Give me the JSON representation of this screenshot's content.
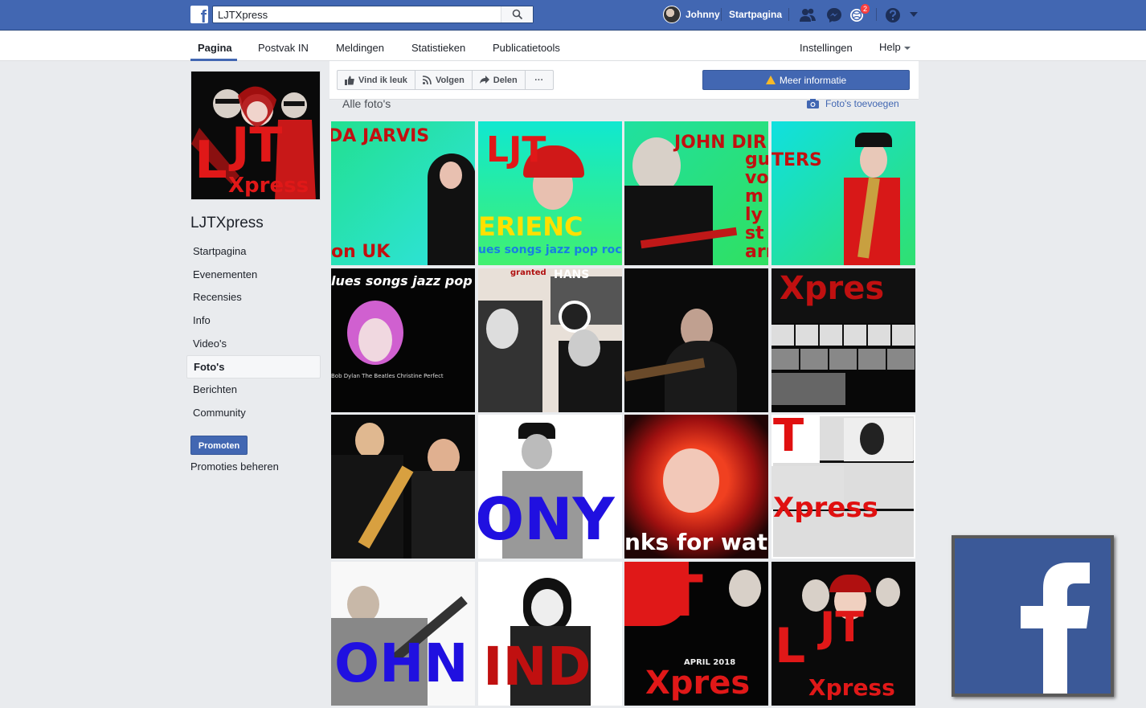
{
  "topbar": {
    "search_value": "LJTXpress",
    "user_name": "Johnny",
    "home_label": "Startpagina",
    "notification_count": "2"
  },
  "pagenav": {
    "tabs": [
      "Pagina",
      "Postvak IN",
      "Meldingen",
      "Statistieken",
      "Publicatietools"
    ],
    "settings": "Instellingen",
    "help": "Help"
  },
  "page": {
    "name": "LJTXpress",
    "profile_text": "LJTXpress"
  },
  "sidebar": {
    "items": [
      "Startpagina",
      "Evenementen",
      "Recensies",
      "Info",
      "Video's",
      "Foto's",
      "Berichten",
      "Community"
    ],
    "promote_label": "Promoten",
    "manage_promotions": "Promoties beheren"
  },
  "actions": {
    "like": "Vind ik leuk",
    "follow": "Volgen",
    "share": "Delen",
    "more": "···",
    "more_info": "Meer informatie"
  },
  "photos": {
    "heading": "Alle foto's",
    "add_label": "Foto's toevoegen",
    "tiles": [
      {
        "text": "DA JARVIS",
        "sub": "ls s nm s on UK"
      },
      {
        "text": "LJT",
        "sub": "ERIENC",
        "caption": "ues songs jazz pop rock"
      },
      {
        "text": "JOHN DIR",
        "sub": "gu vo m ly st arn"
      },
      {
        "text": "TERS",
        "sub": "n"
      },
      {
        "text": "lues songs jazz pop ro",
        "sub": "Bob Dylan The Beatles Christine Perfect"
      },
      {
        "text": "HANS",
        "sub": "granted"
      },
      {
        "text": ""
      },
      {
        "text": "Xpres"
      },
      {
        "text": ""
      },
      {
        "text": "ONY"
      },
      {
        "text": "nks for watc"
      },
      {
        "text": "Xpress"
      },
      {
        "text": "OHN"
      },
      {
        "text": "IND"
      },
      {
        "text": "Xpres",
        "sub": "APRIL 2018"
      },
      {
        "text": "Xpress"
      }
    ]
  },
  "colors": {
    "brand_blue": "#4267b2",
    "page_bg": "#e9ebee"
  }
}
